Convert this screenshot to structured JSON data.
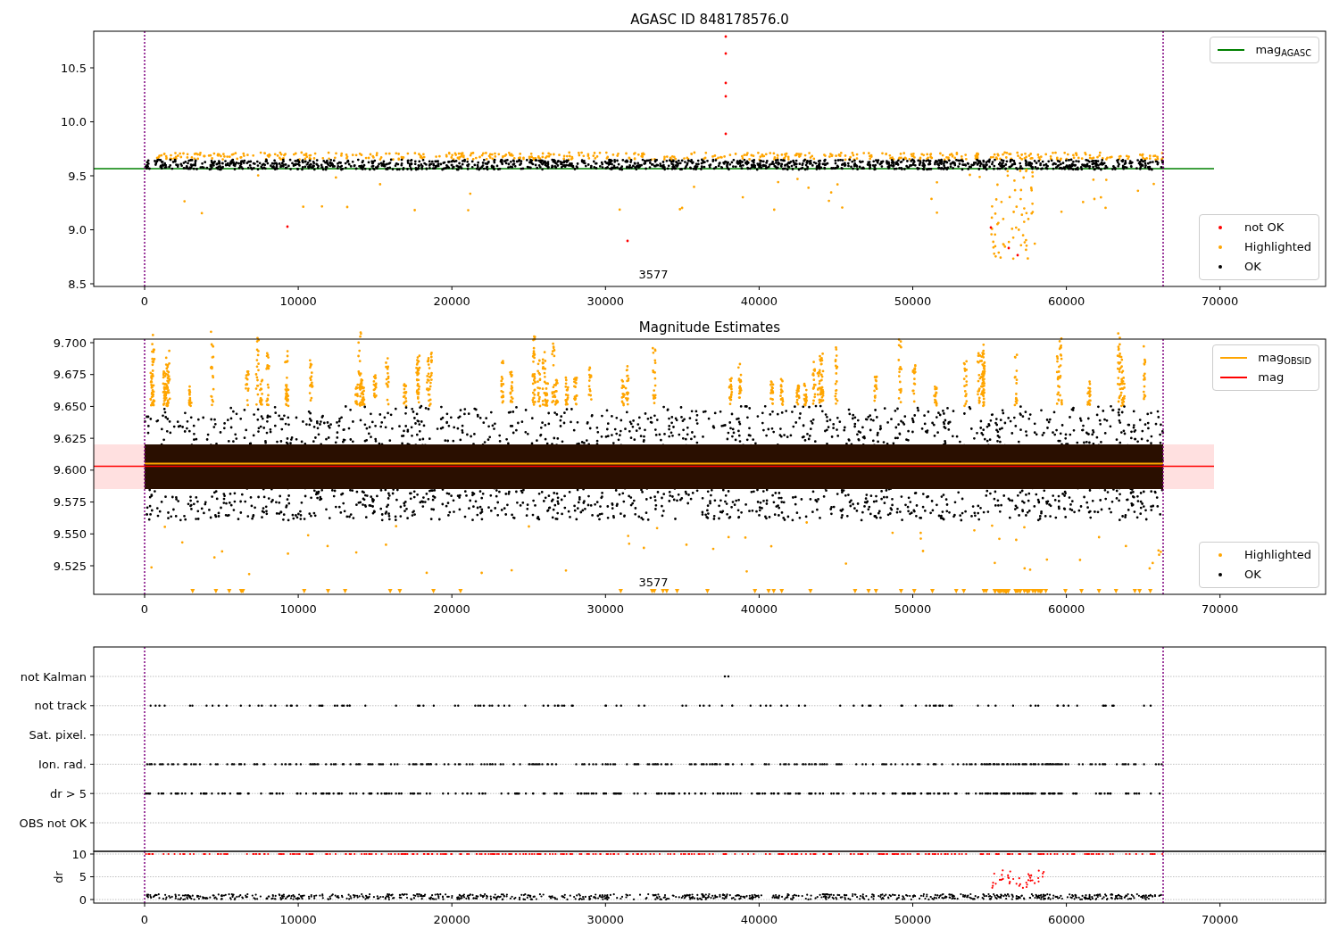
{
  "panels": [
    {
      "kind": "agasc",
      "title": "AGASC ID 848178576.0",
      "yticks": [
        "10.5",
        "10.0",
        "9.5",
        "9.0",
        "8.5"
      ],
      "xticks": [
        "0",
        "10000",
        "20000",
        "30000",
        "40000",
        "50000",
        "60000",
        "70000"
      ],
      "note": "3577",
      "legends": [
        [
          {
            "kind": "line",
            "color": "#008000",
            "label": "mag$_{AGASC}$"
          }
        ],
        [
          {
            "kind": "dot",
            "color": "#ff0000",
            "label": "not OK"
          },
          {
            "kind": "dot",
            "color": "#ffa500",
            "label": "Highlighted"
          },
          {
            "kind": "dot",
            "color": "#000000",
            "label": "OK"
          }
        ]
      ]
    },
    {
      "kind": "estimates",
      "title": "Magnitude Estimates",
      "yticks": [
        "9.700",
        "9.675",
        "9.650",
        "9.625",
        "9.600",
        "9.575",
        "9.550",
        "9.525"
      ],
      "xticks": [
        "0",
        "10000",
        "20000",
        "30000",
        "40000",
        "50000",
        "60000",
        "70000"
      ],
      "note": "3577",
      "legends": [
        [
          {
            "kind": "line",
            "color": "#ffa500",
            "label": "mag$_{OBSID}$"
          },
          {
            "kind": "line",
            "color": "#ff0000",
            "label": "mag"
          }
        ],
        [
          {
            "kind": "dot",
            "color": "#ffa500",
            "label": "Highlighted"
          },
          {
            "kind": "dot",
            "color": "#000000",
            "label": "OK"
          }
        ]
      ]
    },
    {
      "kind": "flags",
      "yticks": [
        "not Kalman",
        "not track",
        "Sat. pixel.",
        "Ion. rad.",
        "dr > 5",
        "OBS not OK"
      ]
    },
    {
      "kind": "dr",
      "ylabel": "dr",
      "yticks": [
        "10",
        "5",
        "0"
      ],
      "xticks": [
        "0",
        "10000",
        "20000",
        "30000",
        "40000",
        "50000",
        "60000",
        "70000"
      ]
    }
  ]
}
